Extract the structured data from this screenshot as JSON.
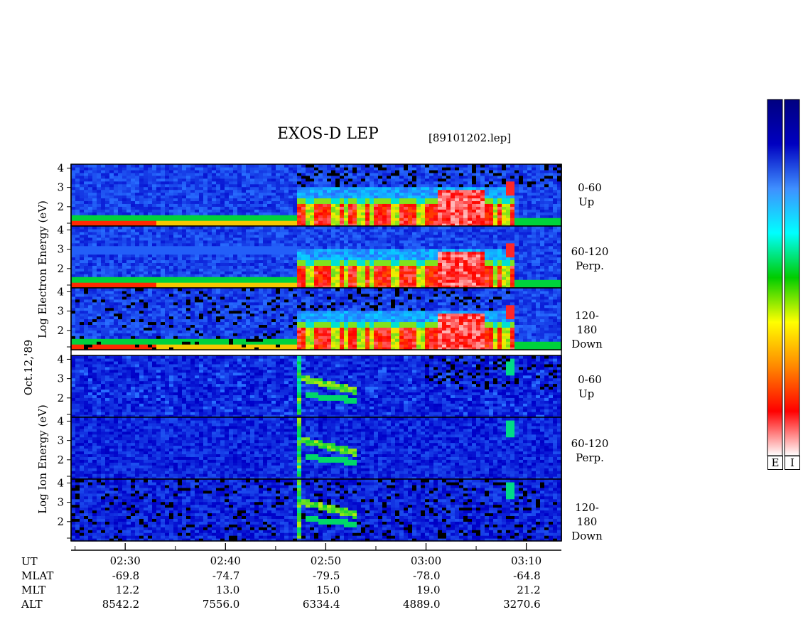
{
  "header": {
    "title": "EXOS-D LEP",
    "filename": "[89101202.lep]"
  },
  "side_labels": {
    "date": "Oct.12,'89",
    "electron_axis": "Log  Electron  Energy (eV)",
    "ion_axis": "Log  Ion  Energy (eV)"
  },
  "panels": [
    {
      "species": "Electron",
      "pitch": "0-60",
      "dir": "Up"
    },
    {
      "species": "Electron",
      "pitch": "60-120",
      "dir": "Perp."
    },
    {
      "species": "Electron",
      "pitch": "120-180",
      "dir": "Down"
    },
    {
      "species": "Ion",
      "pitch": "0-60",
      "dir": "Up"
    },
    {
      "species": "Ion",
      "pitch": "60-120",
      "dir": "Perp."
    },
    {
      "species": "Ion",
      "pitch": "120-180",
      "dir": "Down"
    }
  ],
  "colorbars": {
    "electron_label": "E",
    "ion_label": "I",
    "colors": [
      "#ffffff",
      "#ff0000",
      "#ff8800",
      "#ffff00",
      "#00cc00",
      "#00ffff",
      "#3f8fff",
      "#0000c0",
      "#000080"
    ]
  },
  "orbit": {
    "row_labels": [
      "UT",
      "MLAT",
      "MLT",
      "ALT"
    ],
    "columns": [
      {
        "UT": "02:30",
        "MLAT": "-69.8",
        "MLT": "12.2",
        "ALT": "8542.2"
      },
      {
        "UT": "02:40",
        "MLAT": "-74.7",
        "MLT": "13.0",
        "ALT": "7556.0"
      },
      {
        "UT": "02:50",
        "MLAT": "-79.5",
        "MLT": "15.0",
        "ALT": "6334.4"
      },
      {
        "UT": "03:00",
        "MLAT": "-78.0",
        "MLT": "19.0",
        "ALT": "4889.0"
      },
      {
        "UT": "03:10",
        "MLAT": "-64.8",
        "MLT": "21.2",
        "ALT": "3270.6"
      }
    ]
  },
  "chart_data": {
    "type": "heatmap",
    "title": "EXOS-D LEP",
    "xlabel": "UT",
    "ylabel": "Log Energy (eV)",
    "y_ticks": [
      "4",
      "3",
      "2"
    ],
    "ylim": [
      1,
      4.2
    ],
    "x_ticks": [
      "02:30",
      "02:40",
      "02:50",
      "03:00",
      "03:10"
    ],
    "series": [
      {
        "species": "Electron",
        "pitch": "0-60",
        "dir": "Up",
        "injection_ut": "02:47"
      },
      {
        "species": "Electron",
        "pitch": "60-120",
        "dir": "Perp.",
        "injection_ut": "02:47"
      },
      {
        "species": "Electron",
        "pitch": "120-180",
        "dir": "Down",
        "injection_ut": "02:47"
      },
      {
        "species": "Ion",
        "pitch": "0-60",
        "dir": "Up",
        "injection_ut": "02:47"
      },
      {
        "species": "Ion",
        "pitch": "60-120",
        "dir": "Perp.",
        "injection_ut": "02:47"
      },
      {
        "species": "Ion",
        "pitch": "120-180",
        "dir": "Down",
        "injection_ut": "02:47"
      }
    ]
  }
}
